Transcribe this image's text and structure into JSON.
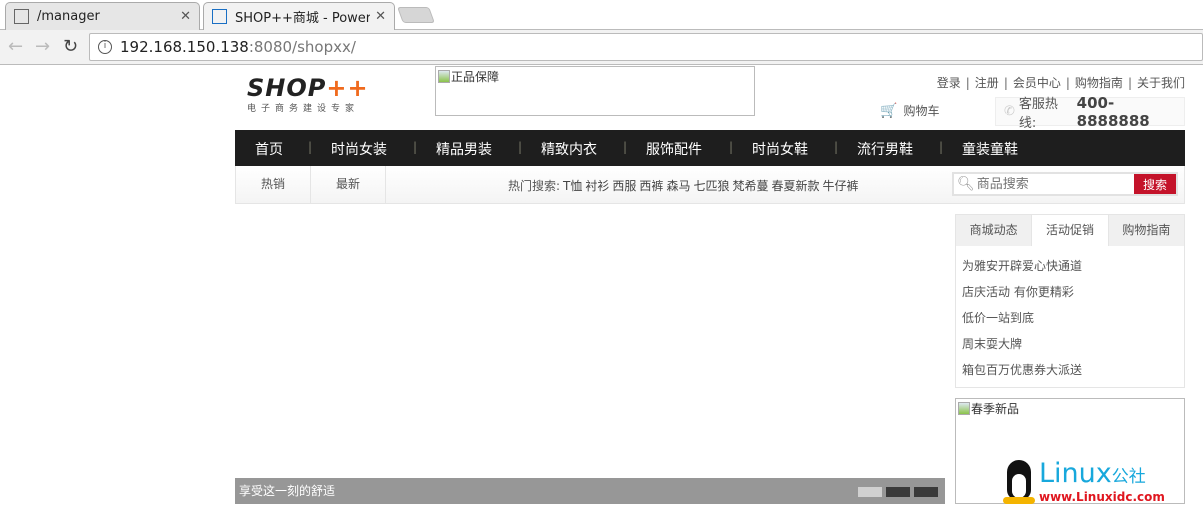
{
  "browser": {
    "tabs": [
      {
        "title": "/manager"
      },
      {
        "title": "SHOP++商城 - Powere"
      }
    ],
    "url_host": "192.168.150.138",
    "url_rest": ":8080/shopxx/"
  },
  "header": {
    "logo_main": "SHOP",
    "logo_plus": "++",
    "logo_sub": "电子商务建设专家",
    "promo_alt": "正品保障",
    "links": [
      "登录",
      "注册",
      "会员中心",
      "购物指南",
      "关于我们"
    ],
    "cart": "购物车",
    "hotline_label": "客服热线:",
    "hotline_number": "400-8888888"
  },
  "nav": {
    "items": [
      "首页",
      "时尚女装",
      "精品男装",
      "精致内衣",
      "服饰配件",
      "时尚女鞋",
      "流行男鞋",
      "童装童鞋"
    ]
  },
  "subnav": {
    "items": [
      "热销",
      "最新"
    ],
    "hot_label": "热门搜索:",
    "hot_keywords": [
      "T恤",
      "衬衫",
      "西服",
      "西裤",
      "森马",
      "七匹狼",
      "梵希蔓",
      "春夏新款",
      "牛仔裤"
    ],
    "search_placeholder": "商品搜索",
    "search_button": "搜索"
  },
  "slider": {
    "caption": "享受这一刻的舒适",
    "slide_count": 3,
    "active_slide": 1
  },
  "panel": {
    "tabs": [
      "商城动态",
      "活动促销",
      "购物指南"
    ],
    "active_tab": 1,
    "items": [
      "为雅安开辟爱心快通道",
      "店庆活动 有你更精彩",
      "低价一站到底",
      "周末耍大牌",
      "箱包百万优惠券大派送"
    ]
  },
  "new_arrivals": {
    "alt": "春季新品"
  },
  "watermark": {
    "brand": "Linux",
    "brand_cn": "公社",
    "url": "www.Linuxidc.com"
  }
}
